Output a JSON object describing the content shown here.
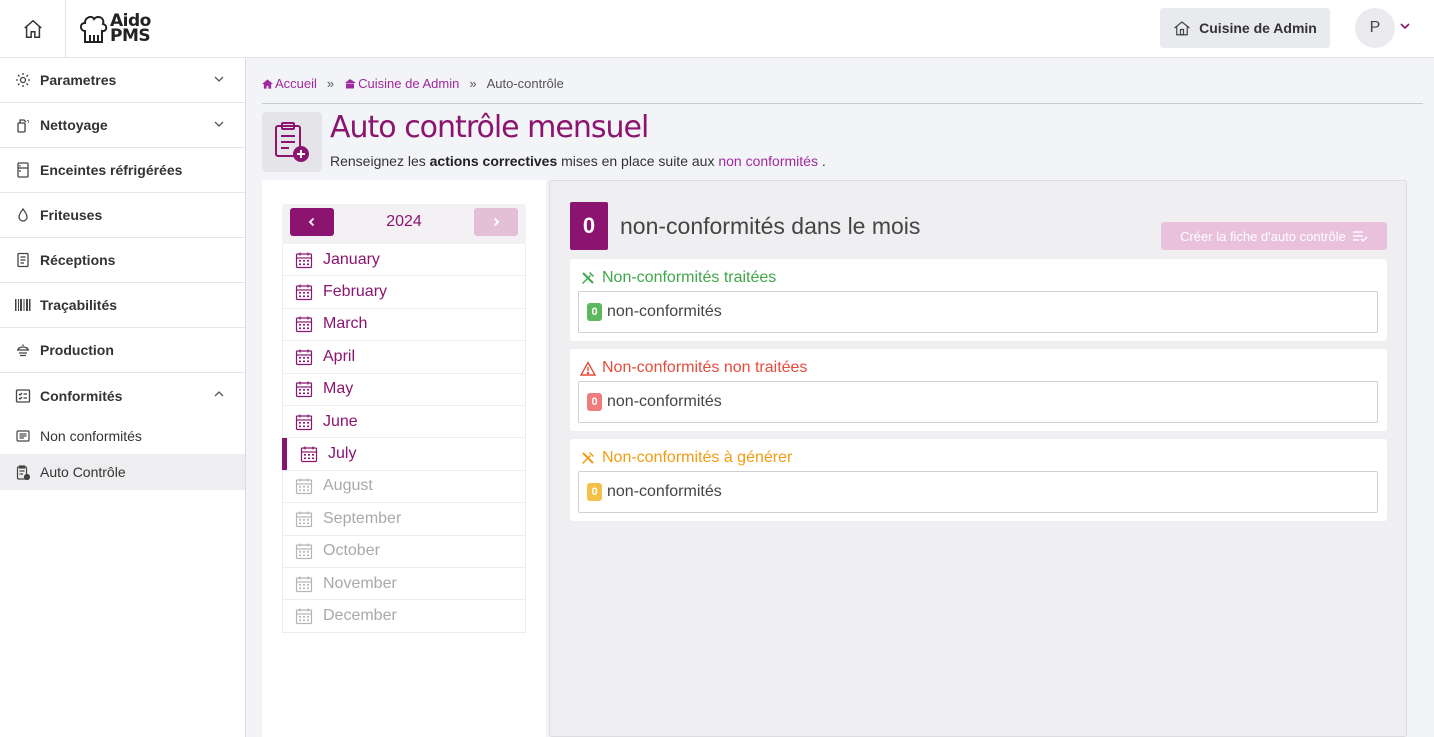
{
  "header": {
    "logo_line1": "Aido",
    "logo_line2": "PMS",
    "kitchen_button": "Cuisine de Admin",
    "avatar_initial": "P"
  },
  "sidebar": {
    "items": [
      {
        "label": "Parametres",
        "icon": "gear-icon",
        "expandable": true
      },
      {
        "label": "Nettoyage",
        "icon": "spray-icon",
        "expandable": true
      },
      {
        "label": "Enceintes réfrigérées",
        "icon": "fridge-icon",
        "expandable": false
      },
      {
        "label": "Friteuses",
        "icon": "drop-icon",
        "expandable": false
      },
      {
        "label": "Réceptions",
        "icon": "receipt-icon",
        "expandable": false
      },
      {
        "label": "Traçabilités",
        "icon": "barcode-icon",
        "expandable": false
      },
      {
        "label": "Production",
        "icon": "production-icon",
        "expandable": false
      },
      {
        "label": "Conformités",
        "icon": "checklist-icon",
        "expandable": true
      }
    ],
    "subitems": [
      {
        "label": "Non conformités",
        "icon": "list-icon"
      },
      {
        "label": "Auto Contrôle",
        "icon": "clipboard-icon"
      }
    ]
  },
  "breadcrumb": {
    "home": "Accueil",
    "kitchen": "Cuisine de Admin",
    "current": "Auto-contrôle",
    "separator": "»"
  },
  "page": {
    "title": "Auto contrôle mensuel",
    "subtitle_pre": "Renseignez les ",
    "subtitle_bold": "actions correctives",
    "subtitle_mid": " mises en place suite aux ",
    "subtitle_link": "non conformités",
    "subtitle_end": " ."
  },
  "calendar": {
    "year": "2024",
    "months": [
      {
        "label": "January",
        "state": "enabled"
      },
      {
        "label": "February",
        "state": "enabled"
      },
      {
        "label": "March",
        "state": "enabled"
      },
      {
        "label": "April",
        "state": "enabled"
      },
      {
        "label": "May",
        "state": "enabled"
      },
      {
        "label": "June",
        "state": "enabled"
      },
      {
        "label": "July",
        "state": "current"
      },
      {
        "label": "August",
        "state": "disabled"
      },
      {
        "label": "September",
        "state": "disabled"
      },
      {
        "label": "October",
        "state": "disabled"
      },
      {
        "label": "November",
        "state": "disabled"
      },
      {
        "label": "December",
        "state": "disabled"
      }
    ]
  },
  "summary": {
    "count": "0",
    "title": "non-conformités dans le mois",
    "create_button": "Créer la fiche d'auto contrôle"
  },
  "sections": [
    {
      "title": "Non-conformités traitées",
      "count": "0",
      "text": "non-conformités",
      "color": "#3fa748",
      "pill_color": "#5cb85c",
      "icon": "tools-icon"
    },
    {
      "title": "Non-conformités non traitées",
      "count": "0",
      "text": "non-conformités",
      "color": "#e74c3c",
      "pill_color": "#f07d7d",
      "icon": "warning-icon"
    },
    {
      "title": "Non-conformités à générer",
      "count": "0",
      "text": "non-conformités",
      "color": "#f39c12",
      "pill_color": "#f5c04a",
      "icon": "tools-icon"
    }
  ],
  "colors": {
    "brand": "#8b1470",
    "link": "#a0299f"
  }
}
